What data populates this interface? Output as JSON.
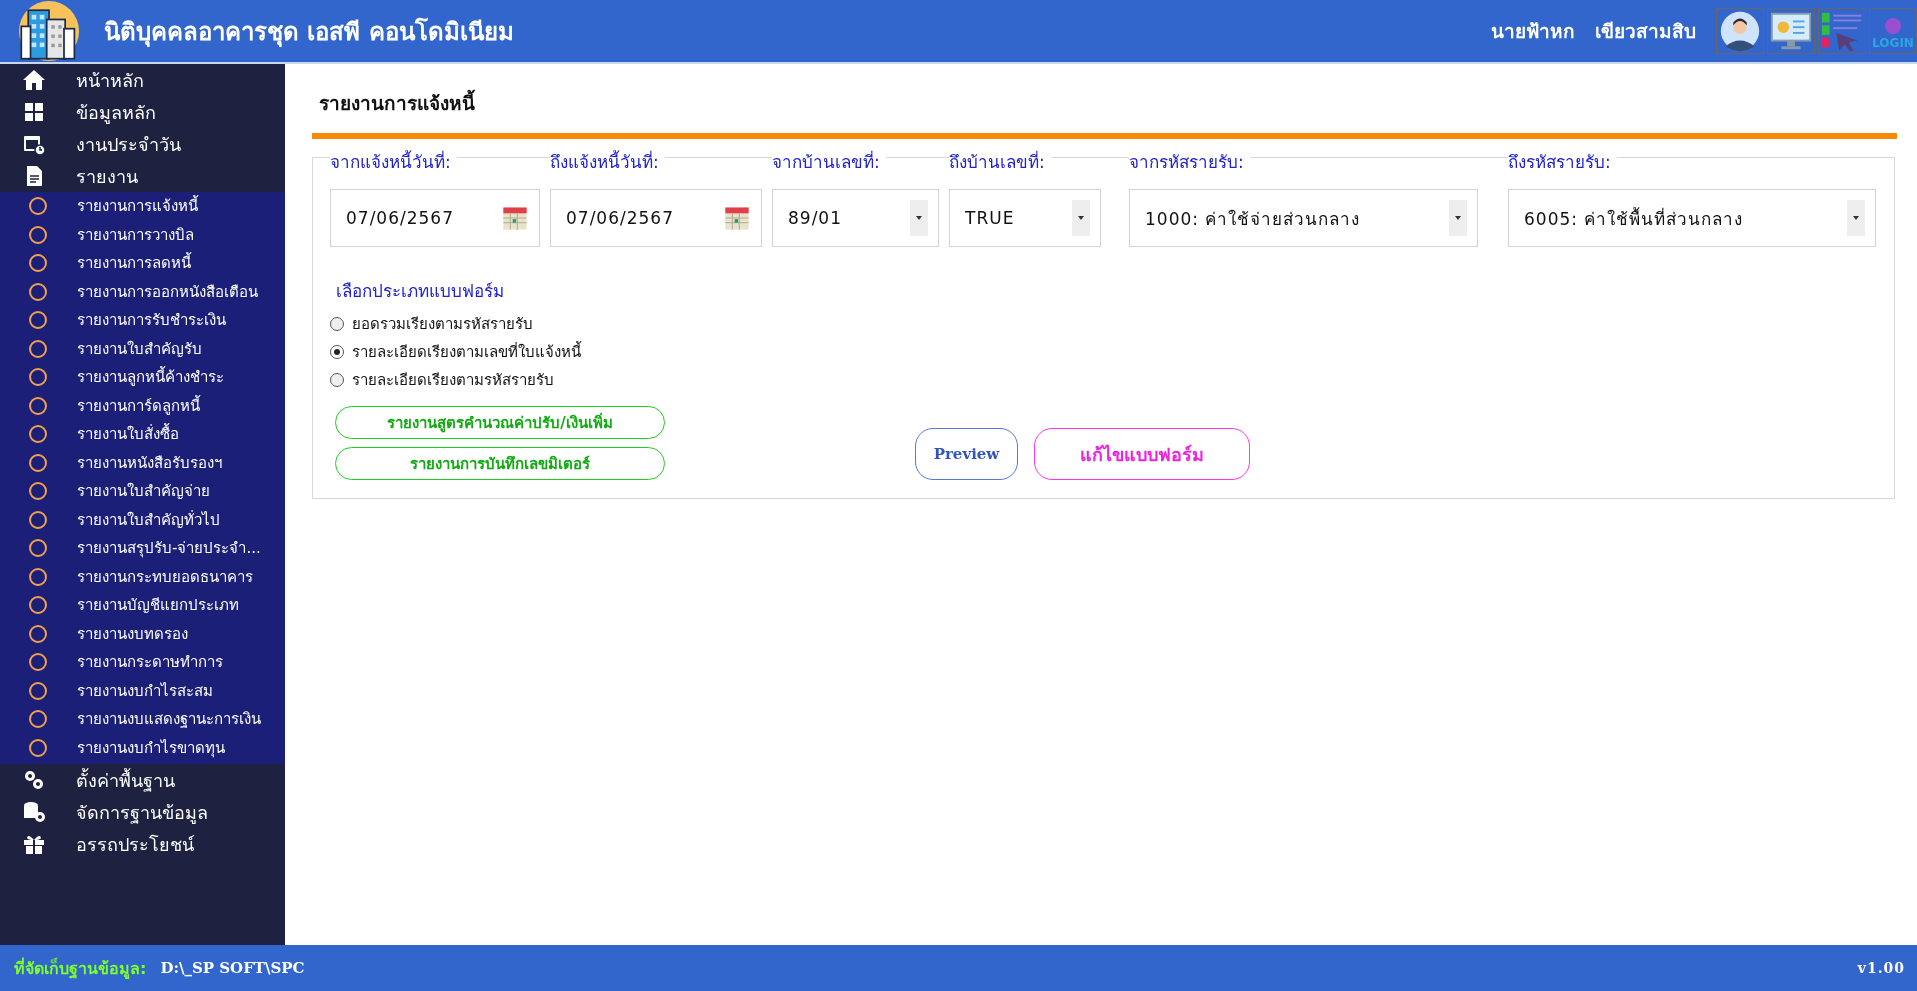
{
  "header": {
    "title": "นิติบุคคลอาคารชุด เอสพี คอนโดมิเนียม",
    "user_first": "นายฟ้าหก",
    "user_last": "เขียวสามสิบ",
    "login_label": "LOGIN"
  },
  "sidebar": {
    "items": [
      {
        "label": "หน้าหลัก"
      },
      {
        "label": "ข้อมูลหลัก"
      },
      {
        "label": "งานประจำวัน"
      },
      {
        "label": "รายงาน",
        "children": [
          {
            "label": "รายงานการแจ้งหนี้"
          },
          {
            "label": "รายงานการวางบิล"
          },
          {
            "label": "รายงานการลดหนี้"
          },
          {
            "label": "รายงานการออกหนังสือเตือน"
          },
          {
            "label": "รายงานการรับชำระเงิน"
          },
          {
            "label": "รายงานใบสำคัญรับ"
          },
          {
            "label": "รายงานลูกหนี้ค้างชำระ"
          },
          {
            "label": "รายงานการ์ดลูกหนี้"
          },
          {
            "label": "รายงานใบสั่งซื้อ"
          },
          {
            "label": "รายงานหนังสือรับรองฯ"
          },
          {
            "label": "รายงานใบสำคัญจ่าย"
          },
          {
            "label": "รายงานใบสำคัญทั่วไป"
          },
          {
            "label": "รายงานสรุปรับ-จ่ายประจำ..."
          },
          {
            "label": "รายงานกระทบยอดธนาคาร"
          },
          {
            "label": "รายงานบัญชีแยกประเภท"
          },
          {
            "label": "รายงานงบทดรอง"
          },
          {
            "label": "รายงานกระดาษทำการ"
          },
          {
            "label": "รายงานงบกำไรสะสม"
          },
          {
            "label": "รายงานงบแสดงฐานะการเงิน"
          },
          {
            "label": "รายงานงบกำไรขาดทุน"
          }
        ]
      },
      {
        "label": "ตั้งค่าพื้นฐาน"
      },
      {
        "label": "จัดการฐานข้อมูล"
      },
      {
        "label": "อรรถประโยชน์"
      }
    ]
  },
  "page": {
    "title": "รายงานการแจ้งหนี้",
    "fields": [
      {
        "kind": "date",
        "label": "จากแจ้งหนี้วันที่:",
        "value": "07/06/2567"
      },
      {
        "kind": "date",
        "label": "ถึงแจ้งหนี้วันที่:",
        "value": "07/06/2567"
      },
      {
        "kind": "select",
        "label": "จากบ้านเลขที่:",
        "value": "89/01"
      },
      {
        "kind": "select",
        "label": "ถึงบ้านเลขที่:",
        "value": "TRUE"
      },
      {
        "kind": "select",
        "label": "จากรหัสรายรับ:",
        "value": "1000: ค่าใช้จ่ายส่วนกลาง"
      },
      {
        "kind": "select",
        "label": "ถึงรหัสรายรับ:",
        "value": "6005: ค่าใช้พื้นที่ส่วนกลาง"
      }
    ],
    "form_type": {
      "label": "เลือกประเภทแบบฟอร์ม",
      "options": [
        {
          "label": "ยอดรวมเรียงตามรหัสรายรับ",
          "selected": false
        },
        {
          "label": "รายละเอียดเรียงตามเลขที่ใบแจ้งหนี้",
          "selected": true
        },
        {
          "label": "รายละเอียดเรียงตามรหัสรายรับ",
          "selected": false
        }
      ]
    },
    "buttons": [
      {
        "kind": "report",
        "label": "รายงานสูตรคำนวณค่าปรับ/เงินเพิ่ม"
      },
      {
        "kind": "report",
        "label": "รายงานการบันทึกเลขมิเตอร์"
      },
      {
        "kind": "preview",
        "label": "Preview"
      },
      {
        "kind": "edit",
        "label": "แก้ไขแบบฟอร์ม"
      }
    ]
  },
  "status_bar": {
    "label": "ที่จัดเก็บฐานข้อมูล:",
    "path": "D:\\_SP SOFT\\SPC",
    "version": "v1.00"
  }
}
